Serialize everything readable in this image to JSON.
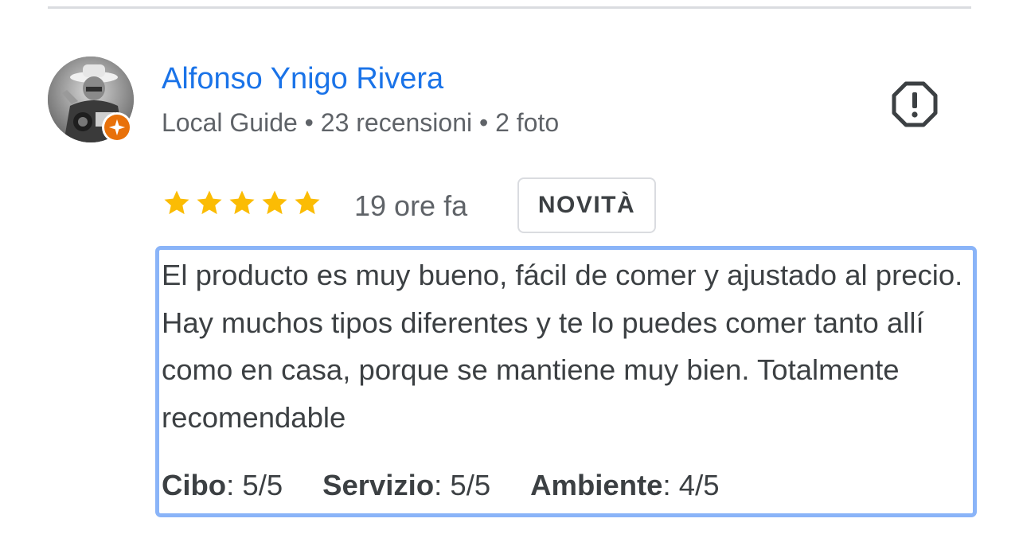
{
  "reviewer": {
    "name": "Alfonso Ynigo Rivera",
    "meta": "Local Guide • 23 recensioni • 2 foto"
  },
  "review": {
    "stars": 5,
    "time": "19 ore fa",
    "badge": "NOVITÀ",
    "text": "El producto es muy bueno, fácil de comer y ajustado al precio. Hay muchos tipos diferentes y te lo puedes comer tanto allí como en casa, porque se mantiene muy bien. Totalmente recomendable",
    "ratings": [
      {
        "label": "Cibo",
        "value": "5/5"
      },
      {
        "label": "Servizio",
        "value": "5/5"
      },
      {
        "label": "Ambiente",
        "value": "4/5"
      }
    ],
    "ratings_separator": ": "
  },
  "icons": {
    "report": "report-flag-icon",
    "local_guide": "local-guide-star-icon",
    "star": "star-icon"
  },
  "colors": {
    "name_link": "#1a73e8",
    "star": "#fbbc04",
    "highlight_border": "#8ab4f8",
    "guide_badge": "#e8710a"
  }
}
